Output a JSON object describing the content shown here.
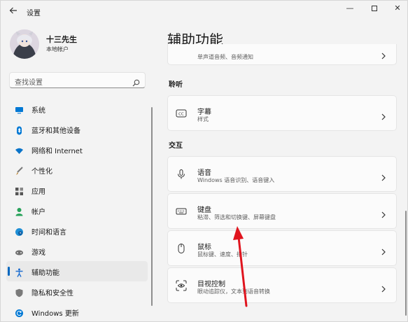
{
  "window": {
    "title": "设置",
    "back_icon": "back-arrow-icon"
  },
  "controls": {
    "minimize": "—",
    "close": "✕"
  },
  "user": {
    "name": "十三先生",
    "account_type": "本地帐户"
  },
  "search": {
    "placeholder": "查找设置"
  },
  "sidebar": {
    "items": [
      {
        "label": "系统",
        "icon": "monitor-icon",
        "color": "#0078d4"
      },
      {
        "label": "蓝牙和其他设备",
        "icon": "bluetooth-icon",
        "color": "#0078d4"
      },
      {
        "label": "网络和 Internet",
        "icon": "wifi-icon",
        "color": "#0a74c9"
      },
      {
        "label": "个性化",
        "icon": "brush-icon",
        "color": "#7a7a7a"
      },
      {
        "label": "应用",
        "icon": "apps-icon",
        "color": "#555555"
      },
      {
        "label": "帐户",
        "icon": "person-icon",
        "color": "#27a25a"
      },
      {
        "label": "时间和语言",
        "icon": "globe-clock-icon",
        "color": "#1f8fd6"
      },
      {
        "label": "游戏",
        "icon": "gamepad-icon",
        "color": "#6e6e6e"
      },
      {
        "label": "辅助功能",
        "icon": "accessibility-icon",
        "color": "#1f6fd0",
        "active": true
      },
      {
        "label": "隐私和安全性",
        "icon": "shield-icon",
        "color": "#7a7a7a"
      },
      {
        "label": "Windows 更新",
        "icon": "update-icon",
        "color": "#0078d4"
      }
    ]
  },
  "main": {
    "title": "辅助功能",
    "partial_card": {
      "desc": "单声道音频、音频通知"
    },
    "sections": [
      {
        "label": "聆听",
        "cards": [
          {
            "title": "字幕",
            "desc": "样式",
            "icon": "captions-icon"
          }
        ]
      },
      {
        "label": "交互",
        "cards": [
          {
            "title": "语音",
            "desc": "Windows 语音识别、语音键入",
            "icon": "microphone-icon"
          },
          {
            "title": "键盘",
            "desc": "粘滞、筛选和切换键、屏幕键盘",
            "icon": "keyboard-icon"
          },
          {
            "title": "鼠标",
            "desc": "鼠标键、速度、指针",
            "icon": "mouse-icon"
          },
          {
            "title": "目视控制",
            "desc": "眼动追踪仪，文本到语音转换",
            "icon": "eye-control-icon"
          }
        ]
      }
    ]
  },
  "accent_color": "#0067c0",
  "annotation_color": "#e0141e"
}
